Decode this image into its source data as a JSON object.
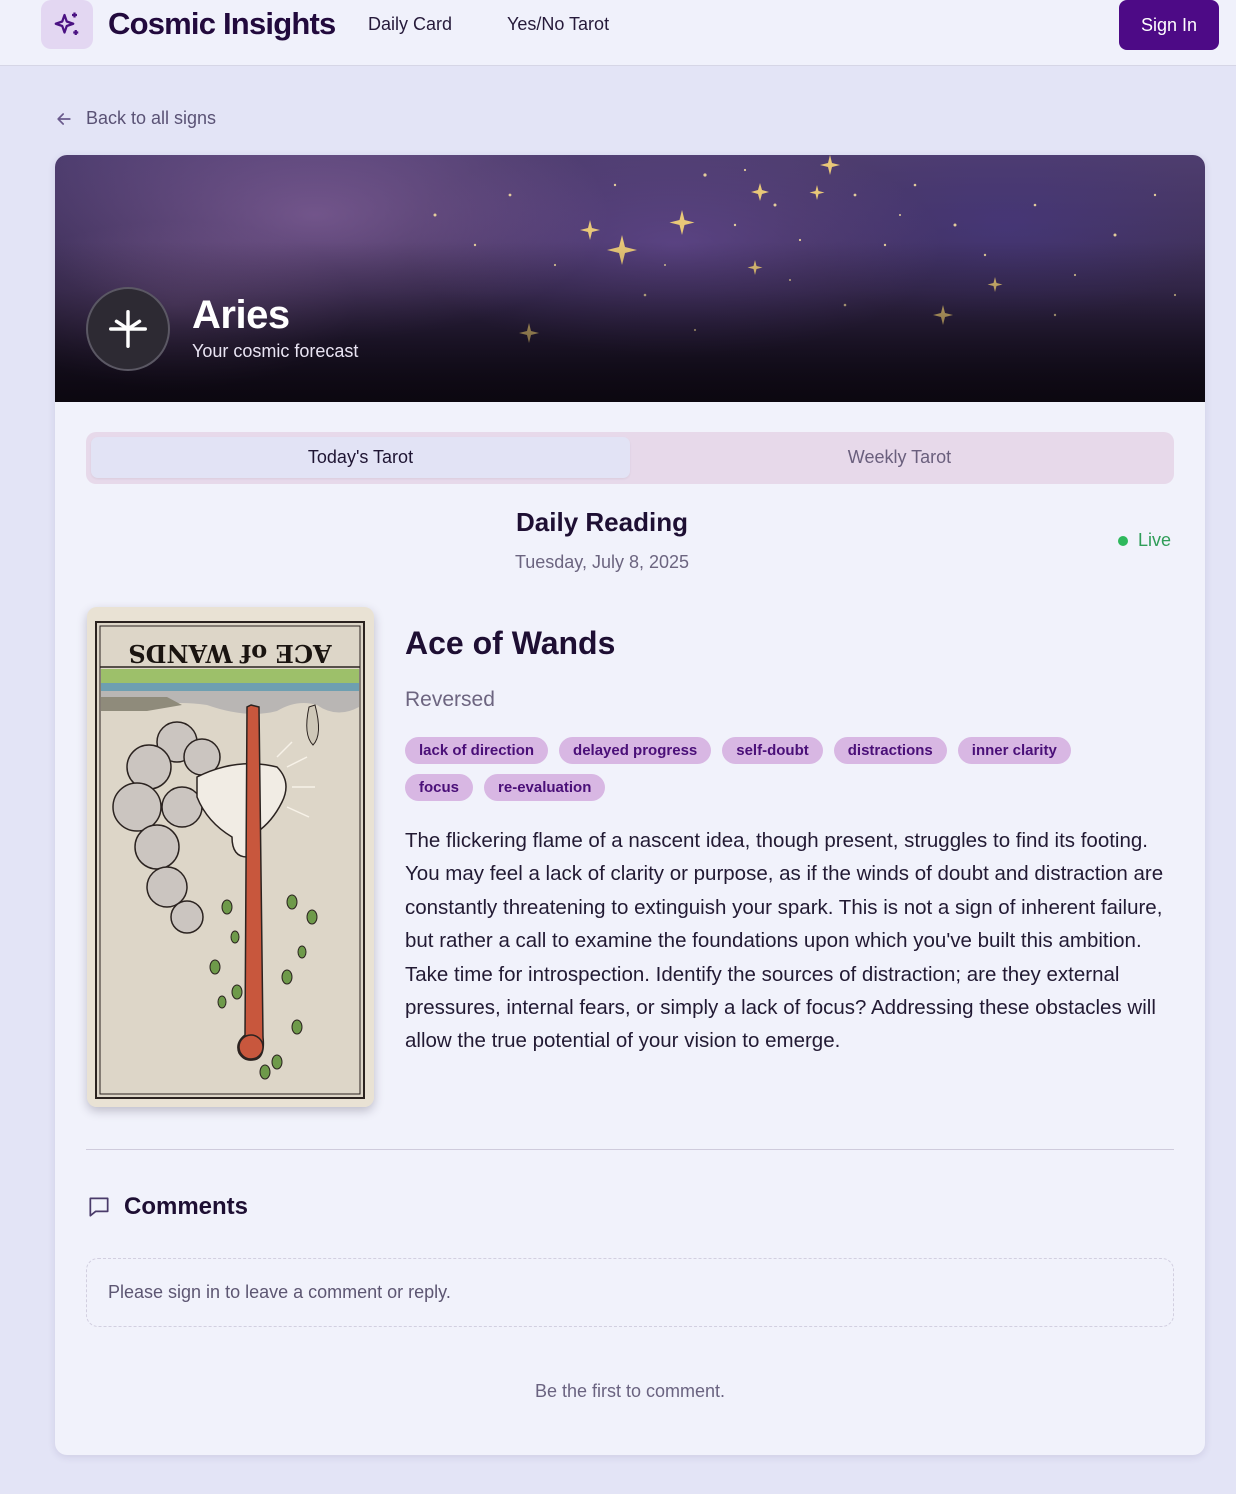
{
  "header": {
    "brand": "Cosmic Insights",
    "logo_icon": "sparkles-icon",
    "nav": [
      {
        "label": "Daily Card"
      },
      {
        "label": "Yes/No Tarot"
      }
    ],
    "sign_in_label": "Sign In"
  },
  "back_link": {
    "label": "Back to all signs",
    "icon": "arrow-left-icon"
  },
  "hero": {
    "sign_name": "Aries",
    "subtitle": "Your cosmic forecast",
    "sign_icon": "aries-sparkle-icon"
  },
  "tabs": [
    {
      "label": "Today's Tarot",
      "active": true
    },
    {
      "label": "Weekly Tarot",
      "active": false
    }
  ],
  "reading": {
    "title": "Daily Reading",
    "date": "Tuesday, July 8, 2025",
    "status": "Live",
    "card_name": "Ace of Wands",
    "orientation": "Reversed",
    "card_image_caption": "ACE of WANDS",
    "keywords": [
      "lack of direction",
      "delayed progress",
      "self-doubt",
      "distractions",
      "inner clarity",
      "focus",
      "re-evaluation"
    ],
    "description": "The flickering flame of a nascent idea, though present, struggles to find its footing. You may feel a lack of clarity or purpose, as if the winds of doubt and distraction are constantly threatening to extinguish your spark. This is not a sign of inherent failure, but rather a call to examine the foundations upon which you've built this ambition. Take time for introspection. Identify the sources of distraction; are they external pressures, internal fears, or simply a lack of focus? Addressing these obstacles will allow the true potential of your vision to emerge."
  },
  "comments": {
    "title": "Comments",
    "icon": "message-square-icon",
    "signin_prompt": "Please sign in to leave a comment or reply.",
    "empty_text": "Be the first to comment."
  },
  "colors": {
    "primary": "#4d0a86",
    "page_bg": "#e3e4f6",
    "chip_bg": "#d8b7e3",
    "live": "#2eb85c"
  }
}
